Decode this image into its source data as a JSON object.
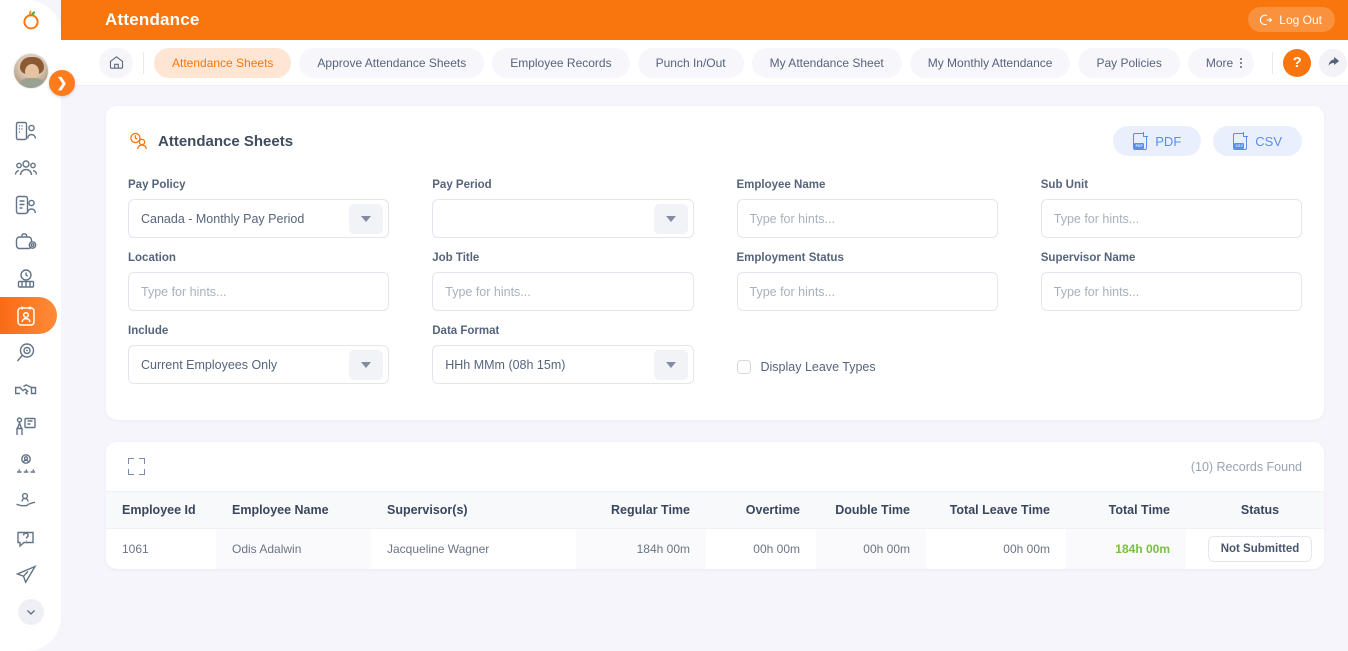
{
  "app": {
    "brand_icon": "orange-logo-icon",
    "header_title": "Attendance",
    "logout_label": "Log Out"
  },
  "sidebar": {
    "avatar_name": "user-avatar",
    "toggle_icon": "chevron-right-icon",
    "items": [
      {
        "name": "admin",
        "icon": "admin-icon",
        "active": false
      },
      {
        "name": "pim",
        "icon": "people-icon",
        "active": false
      },
      {
        "name": "leave",
        "icon": "leave-document-icon",
        "active": false
      },
      {
        "name": "recruitment",
        "icon": "briefcase-gear-icon",
        "active": false
      },
      {
        "name": "time",
        "icon": "clock-calendar-icon",
        "active": false
      },
      {
        "name": "attendance",
        "icon": "attendance-calendar-icon",
        "active": true
      },
      {
        "name": "performance",
        "icon": "magnifier-target-icon",
        "active": false
      },
      {
        "name": "onboarding",
        "icon": "handshake-icon",
        "active": false
      },
      {
        "name": "training",
        "icon": "presentation-icon",
        "active": false
      },
      {
        "name": "succession",
        "icon": "user-hierarchy-icon",
        "active": false
      },
      {
        "name": "benefits",
        "icon": "hand-user-icon",
        "active": false
      },
      {
        "name": "helpdesk",
        "icon": "question-chat-icon",
        "active": false
      },
      {
        "name": "travel",
        "icon": "airplane-icon",
        "active": false
      }
    ],
    "more_icon": "chevron-down-icon"
  },
  "navbar": {
    "home_icon": "home-icon",
    "tabs": [
      {
        "label": "Attendance Sheets",
        "active": true
      },
      {
        "label": "Approve Attendance Sheets",
        "active": false
      },
      {
        "label": "Employee Records",
        "active": false
      },
      {
        "label": "Punch In/Out",
        "active": false
      },
      {
        "label": "My Attendance Sheet",
        "active": false
      },
      {
        "label": "My Monthly Attendance",
        "active": false
      },
      {
        "label": "Pay Policies",
        "active": false
      }
    ],
    "more_label": "More",
    "more_icon": "vertical-dots-icon",
    "help_label": "?",
    "help_icon": "help-icon",
    "share_icon": "share-arrow-icon"
  },
  "card": {
    "icon": "attendance-sheet-icon",
    "title": "Attendance Sheets",
    "pdf_label": "PDF",
    "pdf_tag": "PDF",
    "csv_label": "CSV",
    "csv_tag": "CSV"
  },
  "filters": {
    "pay_policy": {
      "label": "Pay Policy",
      "value": "Canada - Monthly Pay Period",
      "type": "select"
    },
    "pay_period": {
      "label": "Pay Period",
      "value": "",
      "type": "select"
    },
    "employee_name": {
      "label": "Employee Name",
      "value": "",
      "placeholder": "Type for hints...",
      "type": "text"
    },
    "sub_unit": {
      "label": "Sub Unit",
      "value": "",
      "placeholder": "Type for hints...",
      "type": "text"
    },
    "location": {
      "label": "Location",
      "value": "",
      "placeholder": "Type for hints...",
      "type": "text"
    },
    "job_title": {
      "label": "Job Title",
      "value": "",
      "placeholder": "Type for hints...",
      "type": "text"
    },
    "employment_status": {
      "label": "Employment Status",
      "value": "",
      "placeholder": "Type for hints...",
      "type": "text"
    },
    "supervisor_name": {
      "label": "Supervisor Name",
      "value": "",
      "placeholder": "Type for hints...",
      "type": "text"
    },
    "include": {
      "label": "Include",
      "value": "Current Employees Only",
      "type": "select"
    },
    "data_format": {
      "label": "Data Format",
      "value": "HHh MMm (08h 15m)",
      "type": "select"
    },
    "display_leave_types": {
      "label": "Display Leave Types",
      "checked": false
    }
  },
  "table": {
    "expand_icon": "expand-icon",
    "records_found": "(10) Records Found",
    "columns": [
      "Employee Id",
      "Employee Name",
      "Supervisor(s)",
      "Regular Time",
      "Overtime",
      "Double Time",
      "Total Leave Time",
      "Total Time",
      "Status"
    ],
    "rows": [
      {
        "employee_id": "1061",
        "employee_name": "Odis Adalwin",
        "supervisors": "Jacqueline Wagner",
        "regular_time": "184h 00m",
        "overtime": "00h 00m",
        "double_time": "00h 00m",
        "total_leave_time": "00h 00m",
        "total_time": "184h 00m",
        "status": "Not Submitted"
      }
    ]
  },
  "colors": {
    "brand_orange": "#f8760d",
    "active_tab_bg": "#ffe6d4",
    "accent_blue": "#5b8def",
    "total_green": "#76c043",
    "page_bg": "#f6f5fb"
  }
}
